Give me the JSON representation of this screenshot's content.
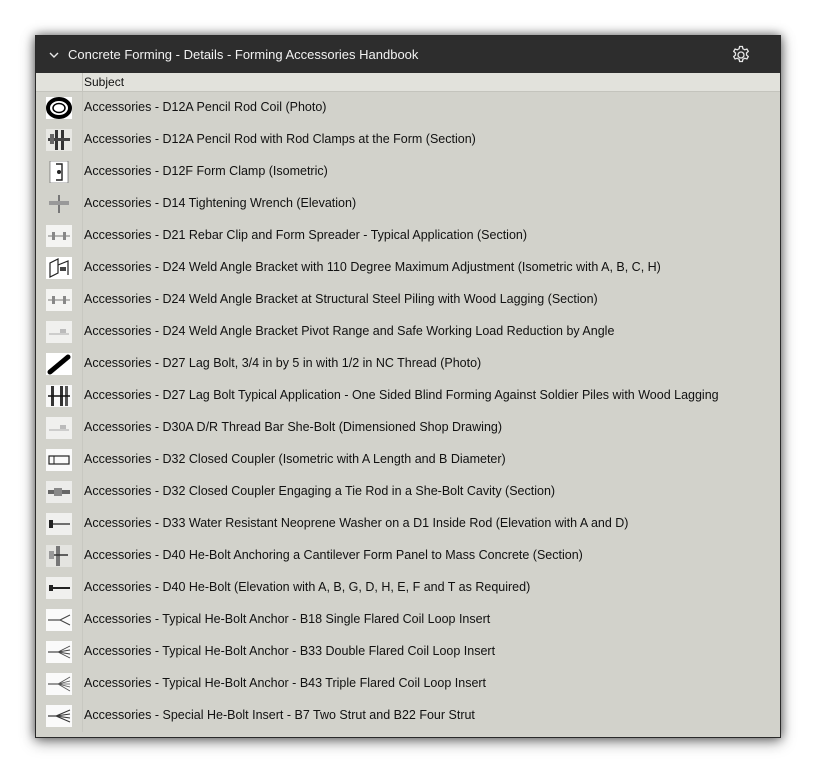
{
  "header": {
    "title": "Concrete Forming - Details - Forming Accessories Handbook",
    "collapse_icon": "chevron-down-icon",
    "settings_icon": "gear-icon"
  },
  "table": {
    "column_subject": "Subject",
    "rows": [
      {
        "subject": "Accessories - D12A Pencil Rod Coil (Photo)",
        "thumb": "coil"
      },
      {
        "subject": "Accessories - D12A Pencil Rod with Rod Clamps at the Form (Section)",
        "thumb": "section"
      },
      {
        "subject": "Accessories - D12F Form Clamp (Isometric)",
        "thumb": "clamp"
      },
      {
        "subject": "Accessories - D14 Tightening Wrench (Elevation)",
        "thumb": "wrench"
      },
      {
        "subject": "Accessories - D21 Rebar Clip and Form Spreader - Typical Application (Section)",
        "thumb": "section-light"
      },
      {
        "subject": "Accessories - D24 Weld Angle Bracket with 110 Degree Maximum Adjustment (Isometric with A, B, C, H)",
        "thumb": "bracket"
      },
      {
        "subject": "Accessories - D24 Weld Angle Bracket at Structural Steel Piling with Wood Lagging (Section)",
        "thumb": "section-light"
      },
      {
        "subject": "Accessories - D24 Weld Angle Bracket Pivot Range and Safe Working Load Reduction by Angle",
        "thumb": "faint"
      },
      {
        "subject": "Accessories - D27 Lag Bolt, 3/4 in by 5 in with 1/2 in NC Thread (Photo)",
        "thumb": "bolt-photo"
      },
      {
        "subject": "Accessories - D27 Lag Bolt Typical Application - One Sided Blind Forming Against Soldier Piles with Wood Lagging",
        "thumb": "lagging"
      },
      {
        "subject": "Accessories - D30A D/R Thread Bar She-Bolt (Dimensioned Shop Drawing)",
        "thumb": "faint"
      },
      {
        "subject": "Accessories - D32 Closed Coupler (Isometric with A Length and B Diameter)",
        "thumb": "coupler"
      },
      {
        "subject": "Accessories - D32 Closed Coupler Engaging a Tie Rod in a She-Bolt Cavity (Section)",
        "thumb": "rod"
      },
      {
        "subject": "Accessories - D33 Water Resistant Neoprene Washer on a D1 Inside Rod (Elevation with A and D)",
        "thumb": "washer"
      },
      {
        "subject": "Accessories - D40 He-Bolt Anchoring a Cantilever Form Panel to Mass Concrete (Section)",
        "thumb": "cantilever"
      },
      {
        "subject": "Accessories - D40 He-Bolt (Elevation with A, B, G, D, H, E, F and T as Required)",
        "thumb": "hebolt"
      },
      {
        "subject": "Accessories - Typical He-Bolt Anchor - B18 Single Flared Coil Loop Insert",
        "thumb": "loop1"
      },
      {
        "subject": "Accessories - Typical He-Bolt Anchor - B33 Double Flared Coil Loop Insert",
        "thumb": "loop2"
      },
      {
        "subject": "Accessories - Typical He-Bolt Anchor - B43 Triple Flared Coil Loop Insert",
        "thumb": "loop3"
      },
      {
        "subject": "Accessories - Special He-Bolt Insert - B7 Two Strut and B22 Four Strut",
        "thumb": "strut"
      }
    ]
  }
}
